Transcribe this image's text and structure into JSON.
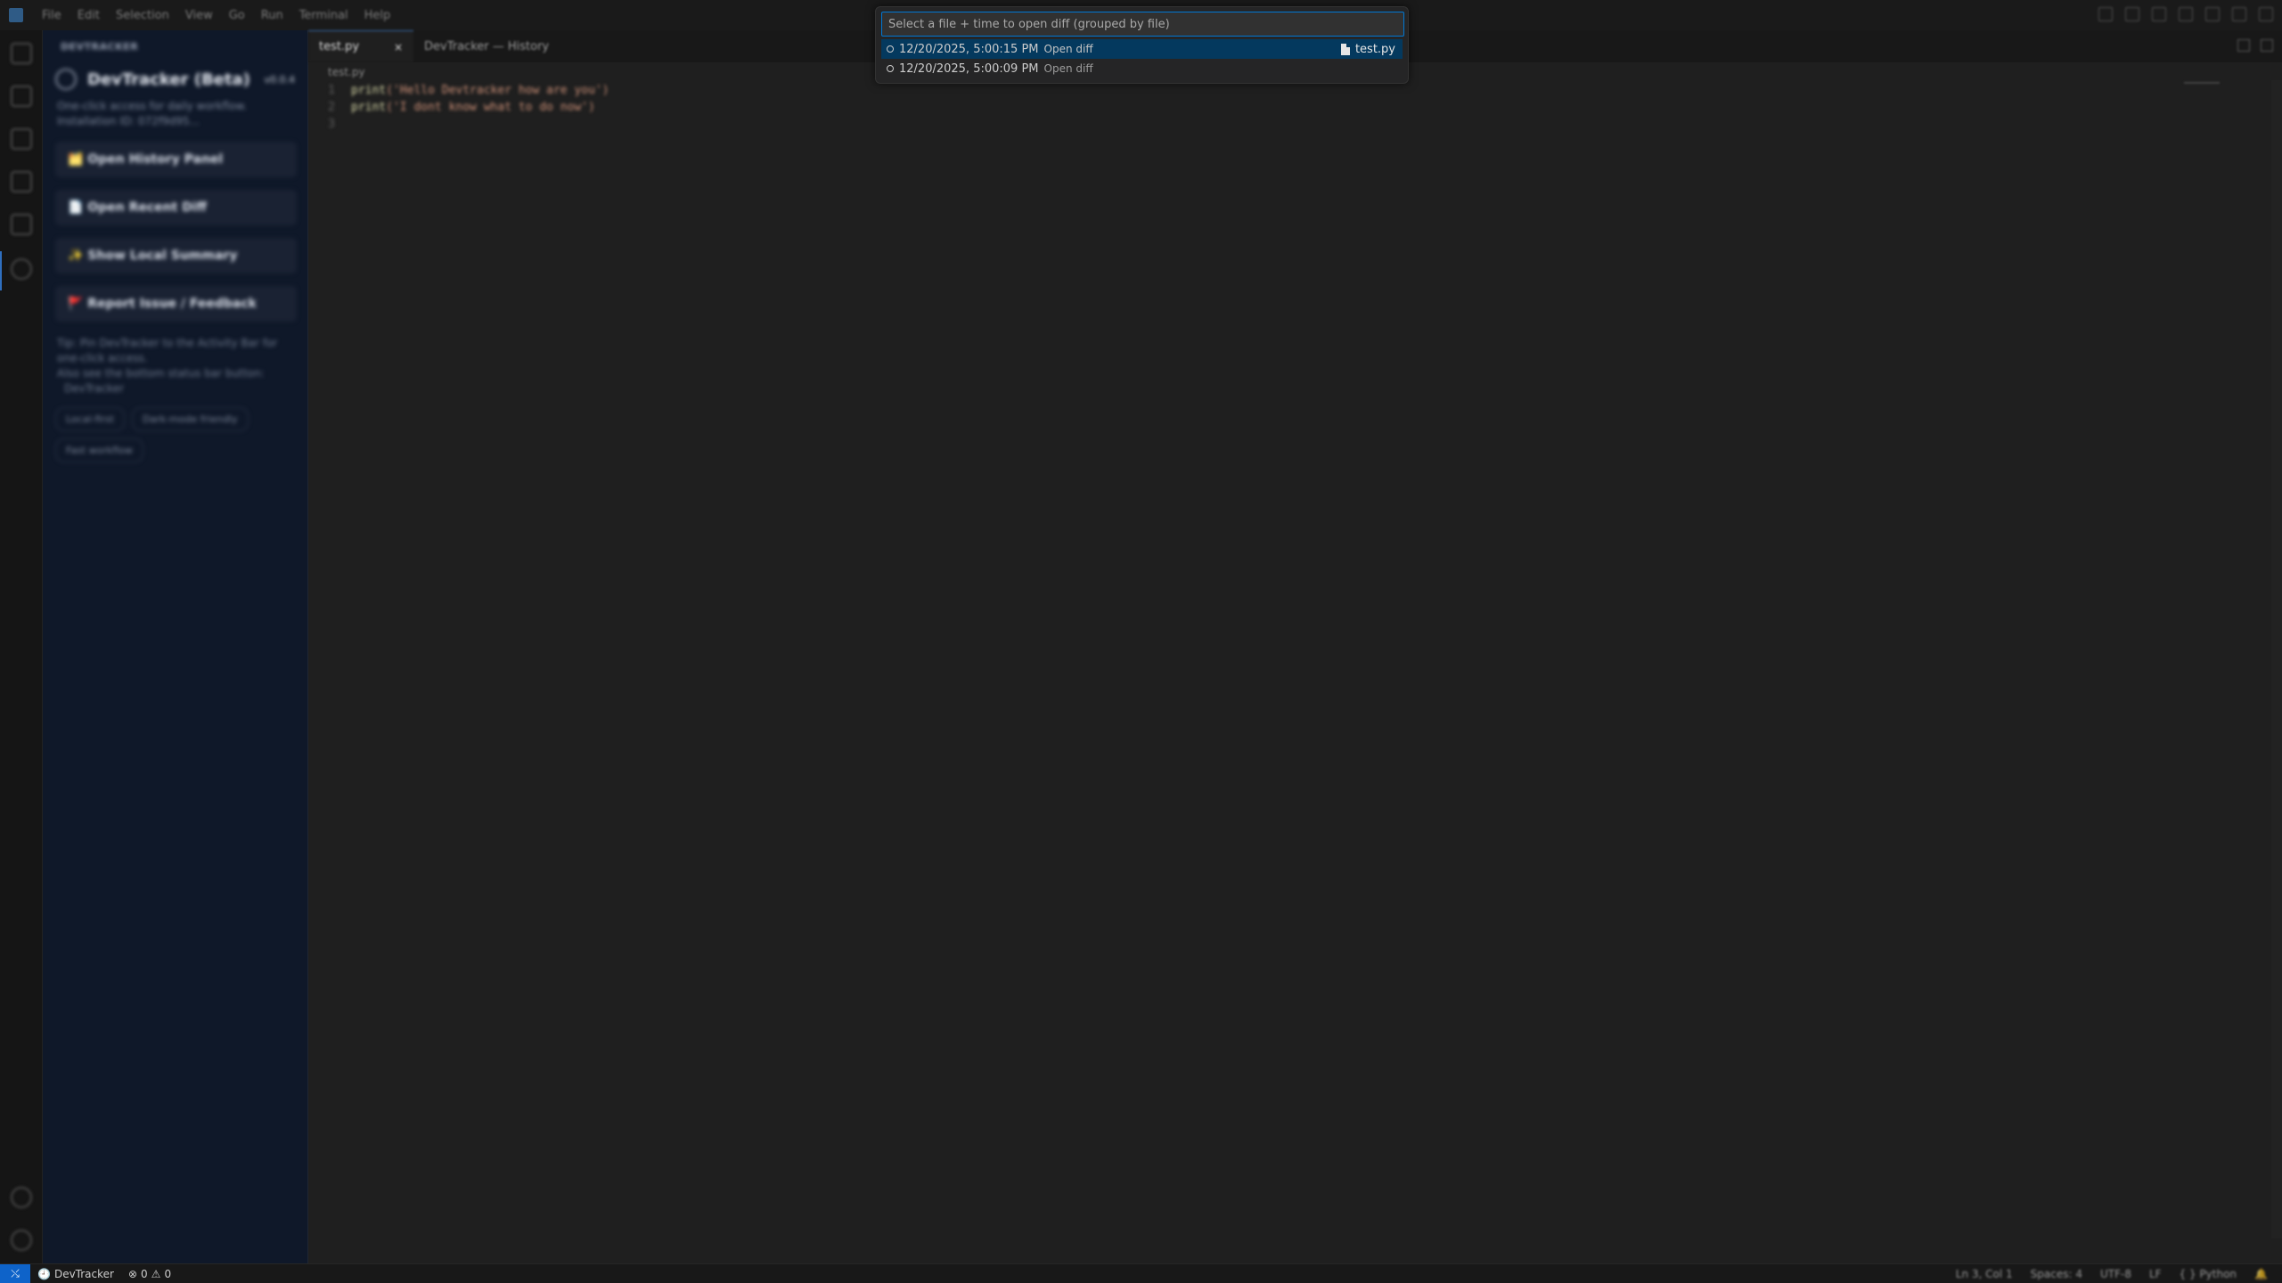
{
  "menu": [
    "File",
    "Edit",
    "Selection",
    "View",
    "Go",
    "Run",
    "Terminal",
    "Help"
  ],
  "sidebar": {
    "header": "DEVTRACKER",
    "title": "DevTracker (Beta)",
    "version": "v0.0.4",
    "description": "One-click access for daily workflow.",
    "installation": "Installation ID: 072f9d95...",
    "buttons": [
      "🗂️ Open History Panel",
      "📄 Open Recent Diff",
      "✨ Show Local Summary",
      "🚩 Report Issue / Feedback"
    ],
    "tip": "Tip: Pin DevTracker to the Activity Bar for one-click access.",
    "tip2": "Also see the bottom status bar button:",
    "tip3": "DevTracker",
    "chips": [
      "Local-first",
      "Dark-mode friendly",
      "Fast workflow"
    ]
  },
  "tabs": {
    "active": "test.py",
    "close": "×",
    "second": "DevTracker — History"
  },
  "editor": {
    "breadcrumb": "test.py",
    "lines": [
      {
        "num": "1",
        "fn": "print",
        "arg": "('Hello Devtracker how are you')"
      },
      {
        "num": "2",
        "fn": "print",
        "arg": " ('I dont know what to do now')"
      },
      {
        "num": "3",
        "fn": "",
        "arg": ""
      }
    ]
  },
  "quickpick": {
    "placeholder": "Select a file + time to open diff (grouped by file)",
    "items": [
      {
        "time": "12/20/2025, 5:00:15 PM",
        "action": "Open diff",
        "file": "test.py",
        "selected": true
      },
      {
        "time": "12/20/2025, 5:00:09 PM",
        "action": "Open diff",
        "file": "",
        "selected": false
      }
    ]
  },
  "statusbar": {
    "remote": "⤯",
    "devtracker": "DevTracker",
    "errors": "0",
    "warnings": "0",
    "right": [
      "Ln 3, Col 1",
      "Spaces: 4",
      "UTF-8",
      "LF",
      "{ } Python",
      "🔔"
    ]
  },
  "colors": {
    "accent": "#0078d4",
    "selection": "#04395e",
    "remote": "#0e63c9",
    "sidebar_bg": "#0f1829"
  }
}
